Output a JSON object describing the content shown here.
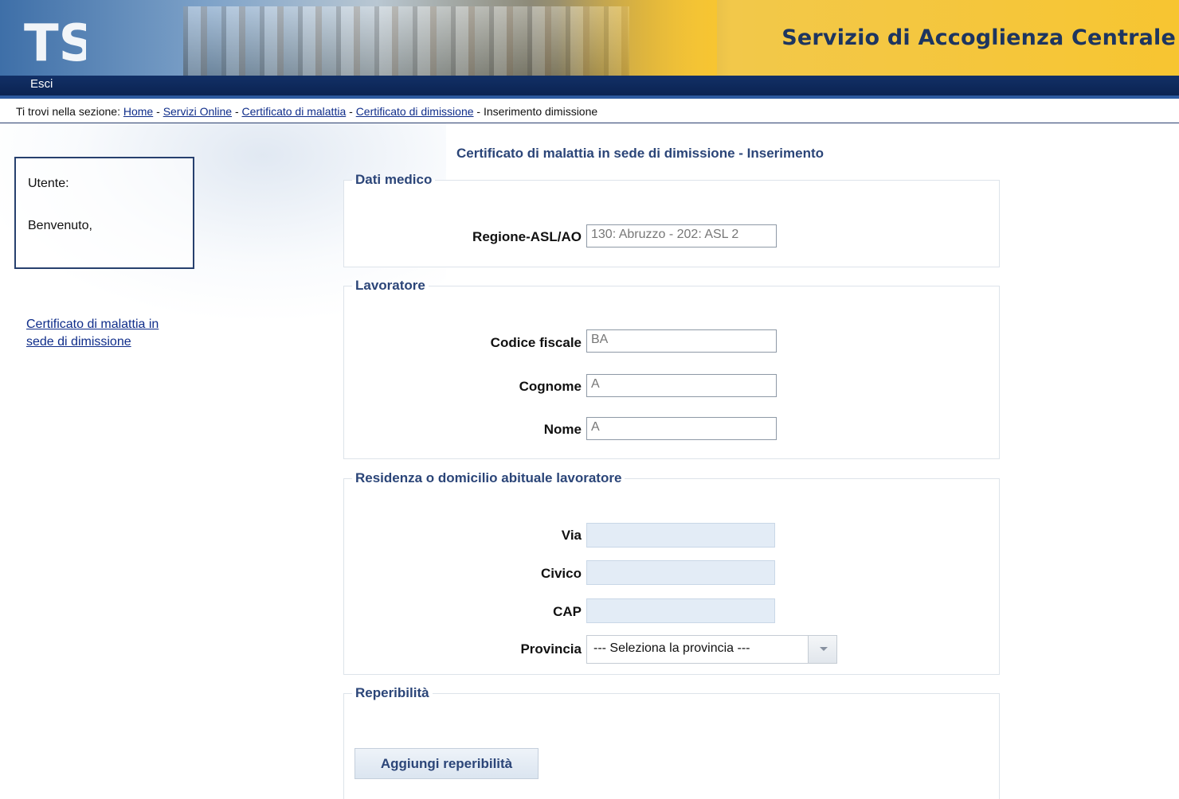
{
  "header": {
    "logo_text": "TS",
    "site_title": "Servizio di Accoglienza Centrale"
  },
  "nav": {
    "exit_label": "Esci"
  },
  "breadcrumb": {
    "prefix": "Ti trovi nella sezione: ",
    "items": [
      "Home",
      "Servizi Online",
      "Certificato di malattia",
      "Certificato di dimissione"
    ],
    "separator": " - ",
    "current": "Inserimento dimissione"
  },
  "sidebar": {
    "user_label": "Utente:",
    "welcome_label": "Benvenuto,",
    "link_line1": "Certificato di malattia in",
    "link_line2": "sede di dimissione"
  },
  "main": {
    "heading": "Certificato di malattia in sede di dimissione - Inserimento",
    "sections": {
      "dati_medico": {
        "legend": "Dati medico",
        "regione_label": "Regione-ASL/AO",
        "regione_value": "130: Abruzzo - 202: ASL 2"
      },
      "lavoratore": {
        "legend": "Lavoratore",
        "codice_fiscale_label": "Codice fiscale",
        "codice_fiscale_value": "BA",
        "cognome_label": "Cognome",
        "cognome_value": "A",
        "nome_label": "Nome",
        "nome_value": "A"
      },
      "residenza": {
        "legend": "Residenza o domicilio abituale lavoratore",
        "via_label": "Via",
        "via_value": "",
        "civico_label": "Civico",
        "civico_value": "",
        "cap_label": "CAP",
        "cap_value": "",
        "provincia_label": "Provincia",
        "provincia_value": "--- Seleziona la provincia ---"
      },
      "reperibilita": {
        "legend": "Reperibilità",
        "add_button": "Aggiungi reperibilità"
      }
    }
  },
  "colors": {
    "navbar": "#0b2352",
    "heading": "#2b4578",
    "link": "#0f2d8a",
    "banner_gold": "#f7c531"
  }
}
